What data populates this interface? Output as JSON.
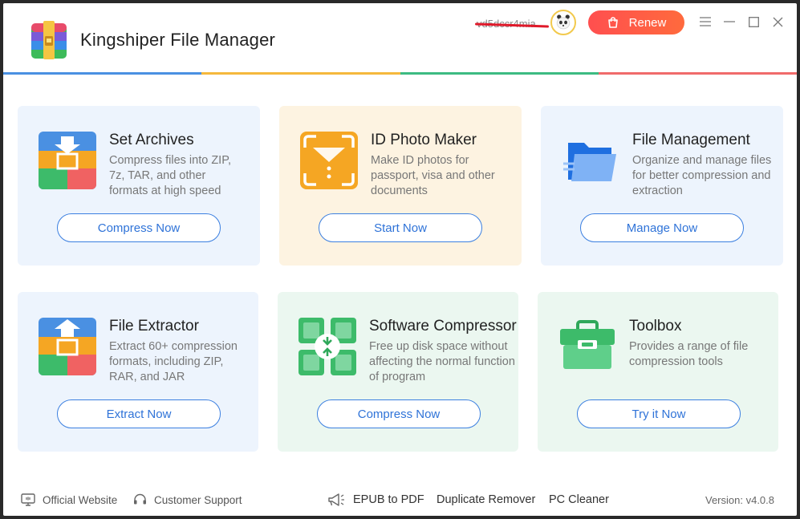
{
  "app": {
    "title": "Kingshiper File Manager"
  },
  "header": {
    "username": "vd5dccr4mia",
    "renew_label": "Renew",
    "accent_colors": [
      "#4a90e2",
      "#f5b83d",
      "#3dbb82",
      "#f06b6b"
    ]
  },
  "cards": [
    {
      "title": "Set Archives",
      "desc": "Compress files into ZIP, 7z, TAR, and other formats at high speed",
      "button": "Compress Now",
      "icon": "archive-compress-icon"
    },
    {
      "title": "ID Photo Maker",
      "desc": "Make ID photos for passport, visa and other documents",
      "button": "Start Now",
      "icon": "id-photo-icon"
    },
    {
      "title": "File Management",
      "desc": "Organize and manage files for better compression and extraction",
      "button": "Manage Now",
      "icon": "folder-icon"
    },
    {
      "title": "File Extractor",
      "desc": "Extract 60+ compression formats, including ZIP, RAR, and JAR",
      "button": "Extract Now",
      "icon": "archive-extract-icon"
    },
    {
      "title": "Software Compressor",
      "desc": "Free up disk space without affecting the normal function of program",
      "button": "Compress Now",
      "icon": "software-compress-icon"
    },
    {
      "title": "Toolbox",
      "desc": "Provides a range of file compression tools",
      "button": "Try it Now",
      "icon": "toolbox-icon"
    }
  ],
  "footer": {
    "official_website": "Official Website",
    "customer_support": "Customer Support",
    "epub_to_pdf": "EPUB to PDF",
    "duplicate_remover": "Duplicate Remover",
    "pc_cleaner": "PC Cleaner",
    "version": "Version: v4.0.8"
  }
}
